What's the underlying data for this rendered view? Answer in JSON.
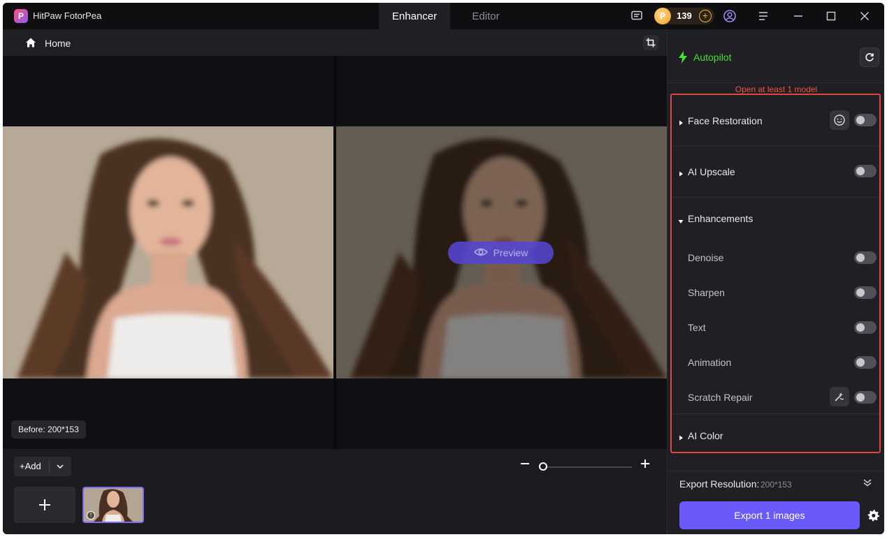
{
  "app": {
    "name": "HitPaw FotorPea",
    "logo_letter": "P"
  },
  "tabs": [
    {
      "label": "Enhancer",
      "active": true
    },
    {
      "label": "Editor",
      "active": false
    }
  ],
  "credits": {
    "count": "139"
  },
  "nav": {
    "home_label": "Home"
  },
  "viewer": {
    "before_badge": "Before: 200*153",
    "preview_label": "Preview"
  },
  "bottom": {
    "add_label": "Add"
  },
  "side": {
    "autopilot_label": "Autopilot",
    "warning": "Open at least 1 model",
    "sections": {
      "face_restoration": "Face Restoration",
      "ai_upscale": "AI Upscale",
      "enhancements": "Enhancements",
      "ai_color": "AI Color"
    },
    "enhancement_items": {
      "denoise": "Denoise",
      "sharpen": "Sharpen",
      "text": "Text",
      "animation": "Animation",
      "scratch_repair": "Scratch Repair"
    },
    "toggles": {
      "face_restoration": false,
      "ai_upscale": false,
      "denoise": false,
      "sharpen": false,
      "text": false,
      "animation": false,
      "scratch_repair": false
    },
    "export_resolution_label": "Export Resolution:",
    "export_resolution_value": "200*153",
    "export_button": "Export 1 images"
  },
  "colors": {
    "accent": "#6a5af9",
    "autopilot": "#4ade38",
    "warning": "#f0553e",
    "highlight_box": "#e0473f"
  }
}
